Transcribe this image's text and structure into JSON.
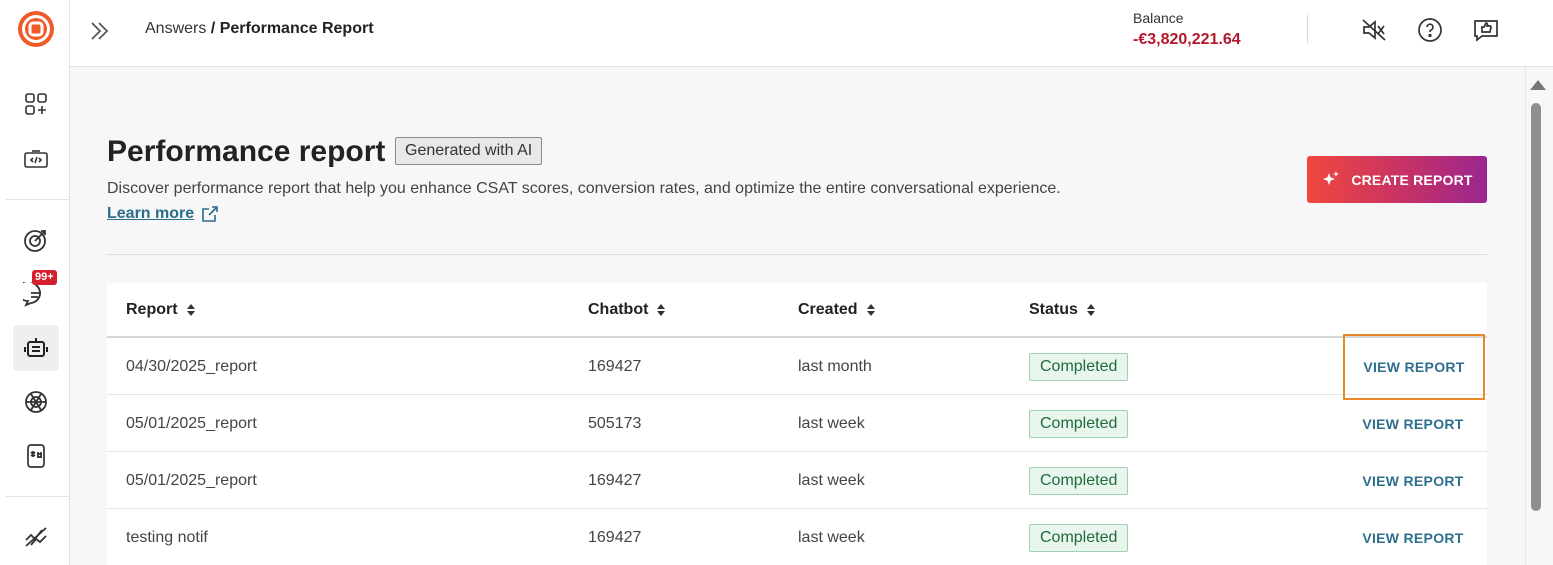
{
  "header": {
    "breadcrumb_parent": "Answers",
    "breadcrumb_sep": " / ",
    "breadcrumb_current": "Performance Report",
    "balance_label": "Balance",
    "balance_value": "-€3,820,221.64"
  },
  "sidebar": {
    "badge": "99+",
    "items": [
      "apps-icon",
      "code-icon",
      "target-icon",
      "chat-icon",
      "bot-icon",
      "openai-icon",
      "shortcuts-icon",
      "flows-icon"
    ]
  },
  "page": {
    "title": "Performance report",
    "tag": "Generated with AI",
    "description": "Discover performance report that help you enhance CSAT scores, conversion rates, and optimize the entire conversational experience.",
    "learn_more": "Learn more",
    "create_button": "CREATE REPORT"
  },
  "table": {
    "columns": [
      "Report",
      "Chatbot",
      "Created",
      "Status"
    ],
    "rows": [
      {
        "report": "04/30/2025_report",
        "chatbot": "169427",
        "created": "last month",
        "status": "Completed",
        "action": "VIEW REPORT"
      },
      {
        "report": "05/01/2025_report",
        "chatbot": "505173",
        "created": "last week",
        "status": "Completed",
        "action": "VIEW REPORT"
      },
      {
        "report": "05/01/2025_report",
        "chatbot": "169427",
        "created": "last week",
        "status": "Completed",
        "action": "VIEW REPORT"
      },
      {
        "report": "testing notif",
        "chatbot": "169427",
        "created": "last week",
        "status": "Completed",
        "action": "VIEW REPORT"
      }
    ]
  },
  "colors": {
    "brand": "#f05a28",
    "balance_negative": "#b3182b",
    "status_green": "#1e6b3d",
    "link": "#2e6f8e",
    "focus": "#e8892a"
  }
}
